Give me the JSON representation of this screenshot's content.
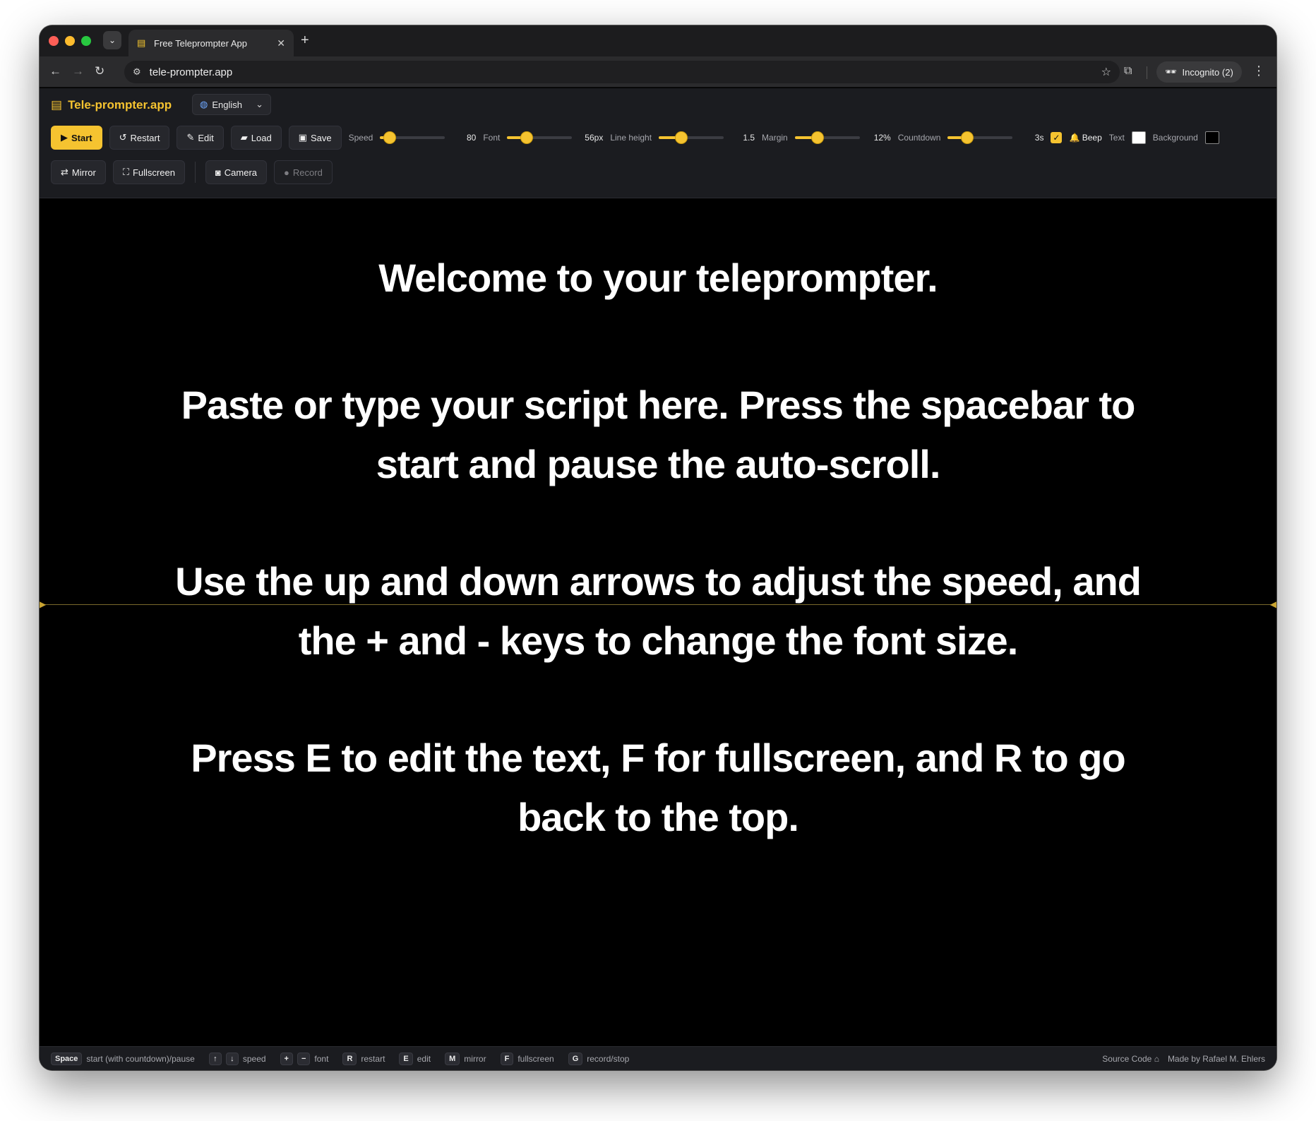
{
  "browser": {
    "tab_title": "Free Teleprompter App",
    "url": "tele-prompter.app",
    "incognito_label": "Incognito (2)"
  },
  "app": {
    "brand": "Tele-prompter.app",
    "language": "English",
    "buttons": {
      "start": "Start",
      "restart": "Restart",
      "edit": "Edit",
      "load": "Load",
      "save": "Save",
      "mirror": "Mirror",
      "fullscreen": "Fullscreen",
      "camera": "Camera",
      "record": "Record"
    },
    "settings": {
      "speed": {
        "label": "Speed",
        "value": "80",
        "level": 0.15
      },
      "font": {
        "label": "Font",
        "value": "56px",
        "level": 0.3
      },
      "line_height": {
        "label": "Line height",
        "value": "1.5",
        "level": 0.35
      },
      "margin": {
        "label": "Margin",
        "value": "12%",
        "level": 0.35
      },
      "countdown": {
        "label": "Countdown",
        "value": "3s",
        "level": 0.3
      },
      "beep": {
        "label": "Beep",
        "checked": true
      },
      "text_color": {
        "label": "Text",
        "color": "#ffffff"
      },
      "background_color": {
        "label": "Background",
        "color": "#000000"
      }
    },
    "accent_color": "#f5c330"
  },
  "script": {
    "paragraphs": [
      "Welcome to your teleprompter.",
      "Paste or type your script here. Press the spacebar to start and pause the auto-scroll.",
      "Use the up and down arrows to adjust the speed, and the + and - keys to change the font size.",
      "Press E to edit the text, F for fullscreen, and R to go back to the top."
    ]
  },
  "footer": {
    "shortcuts": [
      {
        "keys": [
          "Space"
        ],
        "desc": "start (with countdown)/pause"
      },
      {
        "keys": [
          "↑",
          "↓"
        ],
        "desc": "speed"
      },
      {
        "keys": [
          "+",
          "−"
        ],
        "desc": "font"
      },
      {
        "keys": [
          "R"
        ],
        "desc": "restart"
      },
      {
        "keys": [
          "E"
        ],
        "desc": "edit"
      },
      {
        "keys": [
          "M"
        ],
        "desc": "mirror"
      },
      {
        "keys": [
          "F"
        ],
        "desc": "fullscreen"
      },
      {
        "keys": [
          "G"
        ],
        "desc": "record/stop"
      }
    ],
    "source_code": "Source Code",
    "made_by": "Made by Rafael M. Ehlers"
  }
}
